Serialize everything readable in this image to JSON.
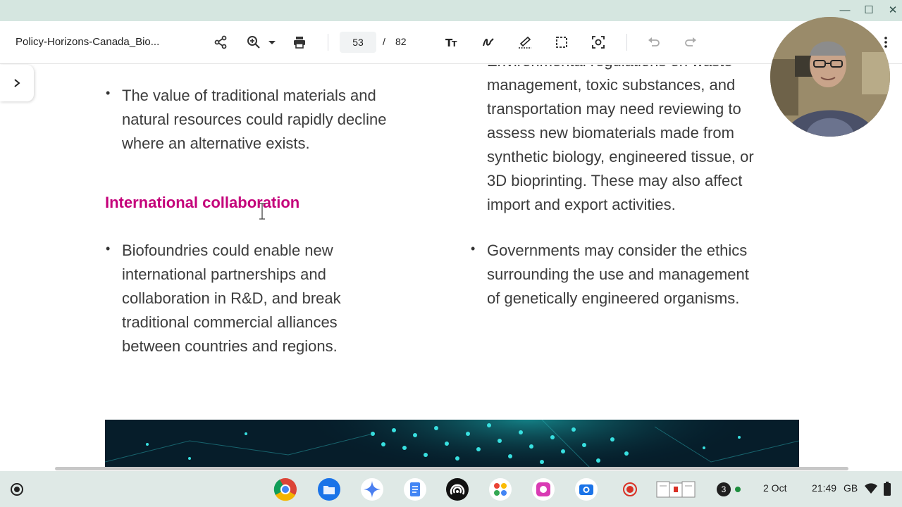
{
  "window": {
    "minimize_icon": "minimize-icon",
    "maximize_icon": "maximize-icon",
    "close_icon": "close-icon"
  },
  "toolbar": {
    "document_title": "Policy-Horizons-Canada_Bio...",
    "current_page": "53",
    "page_separator": "/",
    "total_pages": "82",
    "icons": [
      "share-icon",
      "zoom-in-icon",
      "chevron-down-icon",
      "print-icon",
      "text-icon",
      "draw-icon",
      "signature-icon",
      "select-area-icon",
      "screenshot-icon",
      "undo-icon",
      "redo-icon",
      "more-icon"
    ]
  },
  "sidebar": {
    "toggle_icon": "chevron-right-icon"
  },
  "document": {
    "right_top_partial": "Environmental regulations on waste",
    "right_top_text": [
      "management, toxic substances, and",
      "transportation may need reviewing to",
      "assess new biomaterials made from",
      "synthetic biology, engineered tissue, or",
      "3D bioprinting. These may also affect",
      "import and export activities."
    ],
    "left_bullet_1": [
      "The value of traditional materials and",
      "natural resources could rapidly decline",
      "where an alternative exists."
    ],
    "section_heading": "International collaboration",
    "left_bullet_2": [
      "Biofoundries could enable new",
      "international partnerships and",
      "collaboration in R&D, and break",
      "traditional commercial alliances",
      "between countries and regions."
    ],
    "right_bullet_2": [
      "Governments may consider the ethics",
      "surrounding the use and management",
      "of genetically engineered organisms."
    ],
    "bullet_char": "•"
  },
  "colors": {
    "heading": "#c4007a",
    "body_text": "#3c3c3c",
    "top_strip": "#d5e6e0",
    "shelf": "#dfe9e6"
  },
  "shelf": {
    "launcher_icon": "launcher-icon",
    "apps": [
      "chrome-icon",
      "files-icon",
      "gemini-icon",
      "docs-icon",
      "podcast-icon",
      "app-grid-icon",
      "canvas-icon",
      "camera-icon",
      "screen-record-icon",
      "tote-icon"
    ],
    "notification_count": "3",
    "date": "2 Oct",
    "time": "21:49",
    "region": "GB"
  }
}
